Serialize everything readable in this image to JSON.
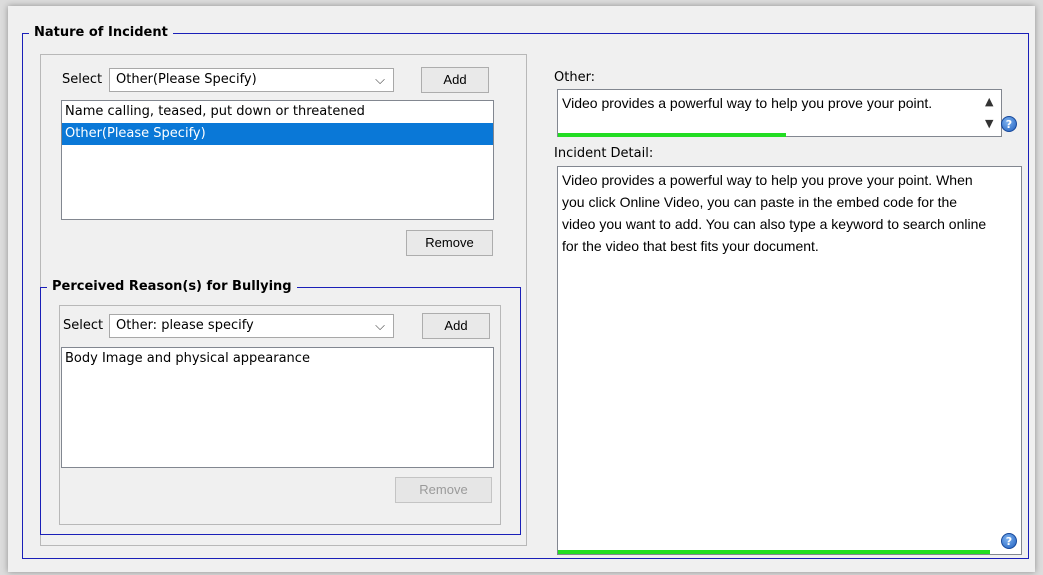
{
  "nature_group": {
    "title": "Nature of Incident",
    "select_label": "Select",
    "selected_value": "Other(Please Specify)",
    "add_label": "Add",
    "remove_label": "Remove",
    "list_items": [
      {
        "text": "Name calling, teased, put down or threatened",
        "selected": false
      },
      {
        "text": "Other(Please Specify)",
        "selected": true
      }
    ]
  },
  "reason_group": {
    "title": "Perceived Reason(s) for Bullying",
    "select_label": "Select",
    "selected_value": "Other: please specify",
    "add_label": "Add",
    "remove_label": "Remove",
    "list_items": [
      {
        "text": "Body Image and physical appearance",
        "selected": false
      }
    ]
  },
  "other": {
    "label": "Other:",
    "value": "Video provides a powerful way to help you prove your point."
  },
  "incident_detail": {
    "label": "Incident Detail:",
    "value": "Video provides a powerful way to help you prove your point. When you click Online Video, you can paste in the embed code for the video you want to add. You can also type a keyword to search online for the video that best fits your document."
  },
  "icons": {
    "help": "?",
    "chevron_down": "⌵",
    "scroll_up": "▲",
    "scroll_down": "▼"
  },
  "colors": {
    "group_border": "#1a1fb8",
    "selection": "#0a78d7",
    "progress_green": "#22dd22"
  }
}
